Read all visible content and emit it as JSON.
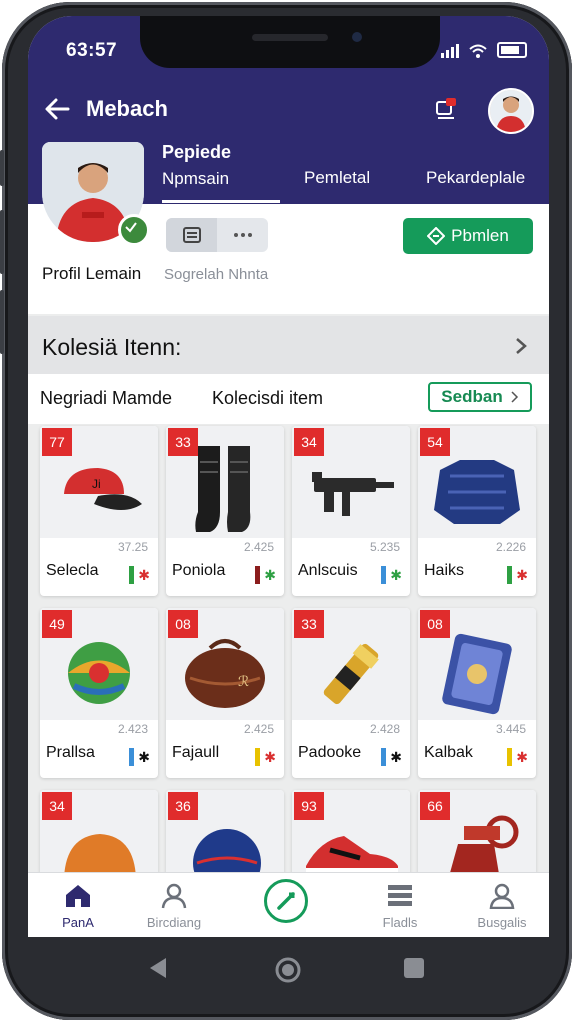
{
  "status_bar": {
    "time": "63:57"
  },
  "header": {
    "title": "Mebach"
  },
  "profile": {
    "tab_main_line1": "Pepiede",
    "tab_main_line2": "Npmsain",
    "tab_2": "Pemletal",
    "tab_3": "Pekardeplale",
    "label": "Profil Lemain",
    "sub": "Sogrelah Nhnta",
    "action_button": "Pbmlen"
  },
  "section": {
    "title": "Kolesiä Itenn:"
  },
  "filters": {
    "left": "Negriadi Mamde",
    "middle": "Kolecisdi item",
    "button": "Sedban"
  },
  "items": [
    {
      "badge": "77",
      "price": "37.25",
      "name": "Selecla",
      "icon": "cap-icon",
      "flag": "#2ea043",
      "star": "#d93030"
    },
    {
      "badge": "33",
      "price": "2.425",
      "name": "Poniola",
      "icon": "boots-icon",
      "flag": "#8b1d1d",
      "star": "#2ea043"
    },
    {
      "badge": "34",
      "price": "5.235",
      "name": "Anlscuis",
      "icon": "gun-icon",
      "flag": "#3b8fd8",
      "star": "#2ea043"
    },
    {
      "badge": "54",
      "price": "2.226",
      "name": "Haiks",
      "icon": "armor-icon",
      "flag": "#2ea043",
      "star": "#d93030"
    },
    {
      "badge": "49",
      "price": "2.423",
      "name": "Prallsa",
      "icon": "ball-icon",
      "flag": "#3b8fd8",
      "star": "#111111"
    },
    {
      "badge": "08",
      "price": "2.425",
      "name": "Fajaull",
      "icon": "bag-icon",
      "flag": "#e8c200",
      "star": "#d93030"
    },
    {
      "badge": "33",
      "price": "2.428",
      "name": "Padooke",
      "icon": "tube-icon",
      "flag": "#3b8fd8",
      "star": "#111111"
    },
    {
      "badge": "08",
      "price": "3.445",
      "name": "Kalbak",
      "icon": "tablet-icon",
      "flag": "#e8c200",
      "star": "#d93030"
    },
    {
      "badge": "34",
      "price": "",
      "name": "",
      "icon": "helmet-icon",
      "flag": "",
      "star": ""
    },
    {
      "badge": "36",
      "price": "",
      "name": "",
      "icon": "sphere-icon",
      "flag": "",
      "star": ""
    },
    {
      "badge": "93",
      "price": "",
      "name": "",
      "icon": "sneaker-icon",
      "flag": "",
      "star": ""
    },
    {
      "badge": "66",
      "price": "",
      "name": "",
      "icon": "machine-icon",
      "flag": "",
      "star": ""
    }
  ],
  "nav": {
    "item1": "PanA",
    "item2": "Bircdiang",
    "item4": "Fladls",
    "item5": "Busgalis"
  },
  "colors": {
    "header": "#2e2a6f",
    "accent_green": "#159b5a",
    "badge_red": "#e02c2c"
  }
}
